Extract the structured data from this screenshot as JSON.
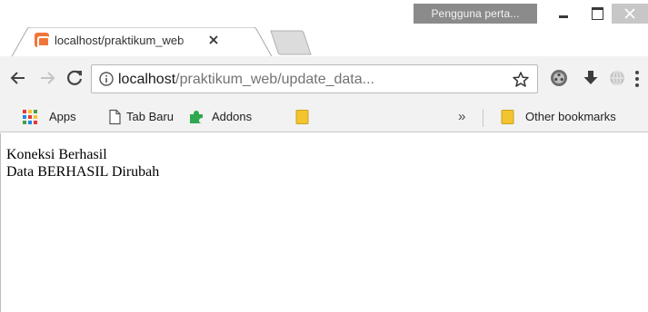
{
  "window": {
    "profile_label": "Pengguna perta..."
  },
  "tab": {
    "title": "localhost/praktikum_web",
    "favicon": "xampp-icon"
  },
  "toolbar": {
    "url_host": "localhost",
    "url_path": "/praktikum_web/update_data..."
  },
  "bookmarks": {
    "items": [
      {
        "label": "Apps",
        "icon": "apps-grid-icon"
      },
      {
        "label": "Tab Baru",
        "icon": "page-icon"
      },
      {
        "label": "Addons",
        "icon": "puzzle-icon"
      }
    ],
    "overflow": "»",
    "other_label": "Other bookmarks"
  },
  "content": {
    "lines": [
      "Koneksi Berhasil",
      "Data BERHASIL Dirubah"
    ]
  },
  "colors": {
    "titlebar": "#ffffff",
    "toolbar": "#f2f2f2",
    "favicon": "#f1753a",
    "puzzle": "#2fa84f",
    "folder": "#f4c430",
    "apps_dots": [
      "#e53935",
      "#fbc02d",
      "#43a047",
      "#1e88e5"
    ]
  }
}
